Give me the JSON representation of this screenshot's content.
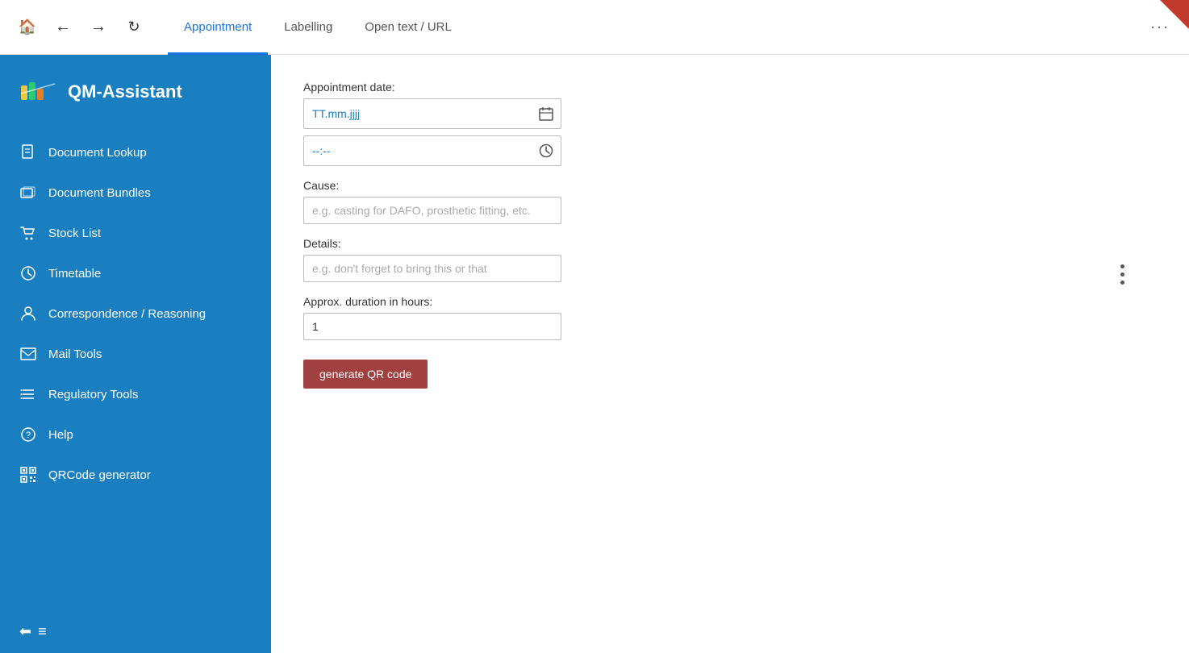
{
  "topbar": {
    "home_icon": "⌂",
    "back_icon": "←",
    "forward_icon": "→",
    "refresh_icon": "↻",
    "more_icon": "···",
    "tabs": [
      {
        "id": "appointment",
        "label": "Appointment",
        "active": true
      },
      {
        "id": "labelling",
        "label": "Labelling",
        "active": false
      },
      {
        "id": "open_text",
        "label": "Open text / URL",
        "active": false
      }
    ]
  },
  "sidebar": {
    "title": "QM-Assistant",
    "items": [
      {
        "id": "document-lookup",
        "label": "Document Lookup",
        "icon": "doc"
      },
      {
        "id": "document-bundles",
        "label": "Document Bundles",
        "icon": "bundle"
      },
      {
        "id": "stock-list",
        "label": "Stock List",
        "icon": "cart"
      },
      {
        "id": "timetable",
        "label": "Timetable",
        "icon": "clock"
      },
      {
        "id": "correspondence",
        "label": "Correspondence / Reasoning",
        "icon": "person"
      },
      {
        "id": "mail-tools",
        "label": "Mail Tools",
        "icon": "mail"
      },
      {
        "id": "regulatory-tools",
        "label": "Regulatory Tools",
        "icon": "list"
      },
      {
        "id": "help",
        "label": "Help",
        "icon": "help"
      },
      {
        "id": "qrcode",
        "label": "QRCode generator",
        "icon": "qr"
      }
    ],
    "collapse_icon": "≡"
  },
  "form": {
    "date_label": "Appointment date:",
    "date_placeholder": "TT.mm.jjjj",
    "time_placeholder": "--:--",
    "cause_label": "Cause:",
    "cause_placeholder": "e.g. casting for DAFO, prosthetic fitting, etc.",
    "details_label": "Details:",
    "details_placeholder": "e.g. don't forget to bring this or that",
    "duration_label": "Approx. duration in hours:",
    "duration_value": "1",
    "generate_btn": "generate QR code"
  }
}
